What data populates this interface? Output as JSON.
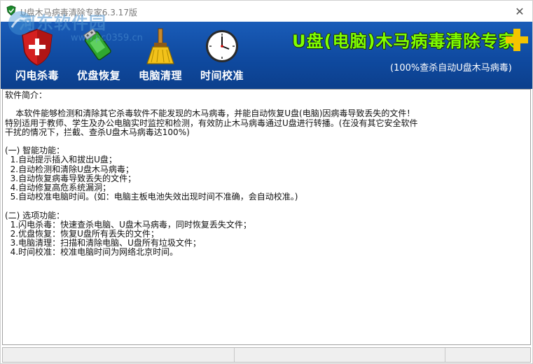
{
  "window": {
    "title": "U盘木马病毒清除专家6.3.17版",
    "close_glyph": "✕"
  },
  "watermark": {
    "text": "河东软件园",
    "url": "www.pc0359.cn"
  },
  "toolbar": {
    "items": [
      {
        "label": "闪电杀毒",
        "icon": "shield-icon"
      },
      {
        "label": "优盘恢复",
        "icon": "usb-drive-icon"
      },
      {
        "label": "电脑清理",
        "icon": "broom-icon"
      },
      {
        "label": "时间校准",
        "icon": "clock-icon"
      }
    ]
  },
  "brand": {
    "title": "U盘(电脑)木马病毒清除专家",
    "subtitle": "(100%查杀自动U盘木马病毒)"
  },
  "content": {
    "lines": [
      "软件简介：",
      "",
      "    本软件能够检测和清除其它杀毒软件不能发现的木马病毒，并能自动恢复U盘(电脑)因病毒导致丢失的文件！",
      "特别适用于教师、学生及办公电脑实时监控和检测，有效防止木马病毒通过U盘进行转播。(在没有其它安全软件",
      "干扰的情况下，拦截、查杀U盘木马病毒达100%)",
      "",
      "(一) 智能功能：",
      "  1.自动提示插入和拔出U盘；",
      "  2.自动检测和清除U盘木马病毒；",
      "  3.自动恢复病毒导致丢失的文件；",
      "  4.自动修复高危系统漏洞；",
      "  5.自动校准电脑时间。(如：电脑主板电池失效出现时间不准确，会自动校准。)",
      "",
      "(二) 选项功能：",
      "  1.闪电杀毒：快速查杀电脑、U盘木马病毒，同时恢复丢失文件；",
      "  2.优盘恢复：恢复U盘所有丢失的文件；",
      "  3.电脑清理：扫描和清除电脑、U盘所有垃圾文件；",
      "  4.时间校准：校准电脑时间为网络北京时间。"
    ]
  },
  "colors": {
    "toolbar_blue": "#0f4aa0",
    "brand_green": "#7fff00",
    "plus_yellow": "#f5c400"
  }
}
